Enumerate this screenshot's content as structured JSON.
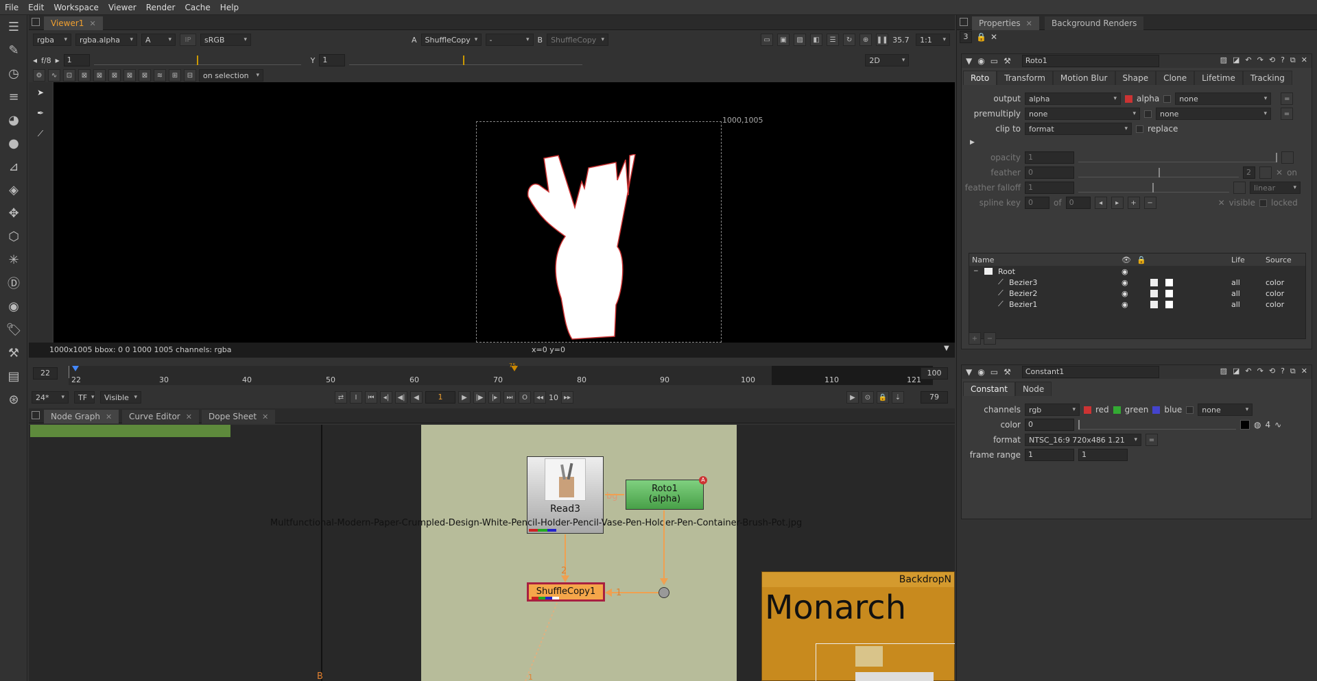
{
  "menu": [
    "File",
    "Edit",
    "Workspace",
    "Viewer",
    "Render",
    "Cache",
    "Help"
  ],
  "viewer": {
    "tab": "Viewer1",
    "channels": "rgba",
    "layer": "rgba.alpha",
    "a_select": "A",
    "ip": "IP",
    "lut": "sRGB",
    "a_label": "A",
    "a_input": "ShuffleCopy",
    "b_dash": "-",
    "b_label": "B",
    "b_input": "ShuffleCopy",
    "zoom": "35.7",
    "ratio": "1:1",
    "fstop": "f/8",
    "gain": "1",
    "y_label": "Y",
    "gamma": "1",
    "gain_ticks": [
      "0.01",
      "0.03",
      "0.1",
      "0.3",
      "1",
      "3",
      "10",
      "30",
      "64"
    ],
    "gamma_ticks": [
      "0",
      "0.1",
      "0.4",
      "0.7",
      "1",
      "2",
      "3",
      "4"
    ],
    "mode": "2D",
    "tool_mode": "on selection",
    "format_label": "1000,1005",
    "info_left": "1000x1005  bbox: 0 0 1000 1005 channels: rgba",
    "info_mid": "x=0 y=0"
  },
  "timeline": {
    "start": "22",
    "end": "100",
    "ticks": [
      "22",
      "30",
      "40",
      "50",
      "60",
      "70",
      "80",
      "90",
      "100",
      "110",
      "121"
    ],
    "marker": "75",
    "fps": "24*",
    "tf": "TF",
    "visible": "Visible",
    "frame": "1",
    "step": "10",
    "end_frame": "79"
  },
  "nodegraph": {
    "tabs": [
      "Node Graph",
      "Curve Editor",
      "Dope Sheet"
    ],
    "read_node": "Read3",
    "read_file": "Multfunctional-Modern-Paper-Crumpled-Design-White-Pencil-Holder-Pencil-Vase-Pen-Holder-Pen-Container-Brush-Pot.jpg",
    "roto_node": "Roto1",
    "roto_sub": "(alpha)",
    "roto_badge": "A",
    "bg_label": "bg",
    "shuffle_node": "ShuffleCopy1",
    "input2": "2",
    "input1": "1",
    "backdrop": "BackdropN",
    "monarch": "Monarch",
    "b_label": "B",
    "one_label": "1"
  },
  "properties": {
    "tabs": [
      "Properties",
      "Background Renders"
    ],
    "count": "3",
    "roto": {
      "name": "Roto1",
      "tabs": [
        "Roto",
        "Transform",
        "Motion Blur",
        "Shape",
        "Clone",
        "Lifetime",
        "Tracking"
      ],
      "output_label": "output",
      "output": "alpha",
      "alpha_label": "alpha",
      "output_none": "none",
      "premult_label": "premultiply",
      "premult": "none",
      "premult2": "none",
      "clip_label": "clip to",
      "clip": "format",
      "replace": "replace",
      "opacity_label": "opacity",
      "opacity": "1",
      "opacity_ticks": [
        "0",
        "0.01",
        "0.1",
        "0.2",
        "0.3",
        "0.4",
        "0.5",
        "0.6",
        "0.7",
        "0.8",
        "0.9",
        "1"
      ],
      "feather_label": "feather",
      "feather": "0",
      "feather_ticks": [
        "-100",
        "-50",
        "-10",
        "0",
        "10",
        "50",
        "100"
      ],
      "feather_n": "2",
      "feather_on": "on",
      "falloff_label": "feather falloff",
      "falloff": "1",
      "falloff_ticks": [
        "0.2",
        "0.4",
        "0.6",
        "1",
        "2",
        "3",
        "4"
      ],
      "falloff_mode": "linear",
      "spline_label": "spline key",
      "spline": "0",
      "of": "of",
      "spline_of": "0",
      "visible": "visible",
      "locked": "locked",
      "columns": [
        "Name",
        "Life",
        "Source"
      ],
      "root": "Root",
      "shapes": [
        {
          "name": "Bezier3",
          "life": "all",
          "source": "color"
        },
        {
          "name": "Bezier2",
          "life": "all",
          "source": "color"
        },
        {
          "name": "Bezier1",
          "life": "all",
          "source": "color"
        }
      ]
    },
    "constant": {
      "name": "Constant1",
      "tabs": [
        "Constant",
        "Node"
      ],
      "channels_label": "channels",
      "channels": "rgb",
      "red": "red",
      "green": "green",
      "blue": "blue",
      "extra": "none",
      "color_label": "color",
      "color": "0",
      "color_ticks": [
        "0",
        "0.1",
        "0.2",
        "0.4",
        "0.6",
        "0.8",
        "1"
      ],
      "color_n": "4",
      "format_label": "format",
      "format": "NTSC_16:9 720x486 1.21",
      "range_label": "frame range",
      "range_start": "1",
      "range_end": "1"
    }
  }
}
